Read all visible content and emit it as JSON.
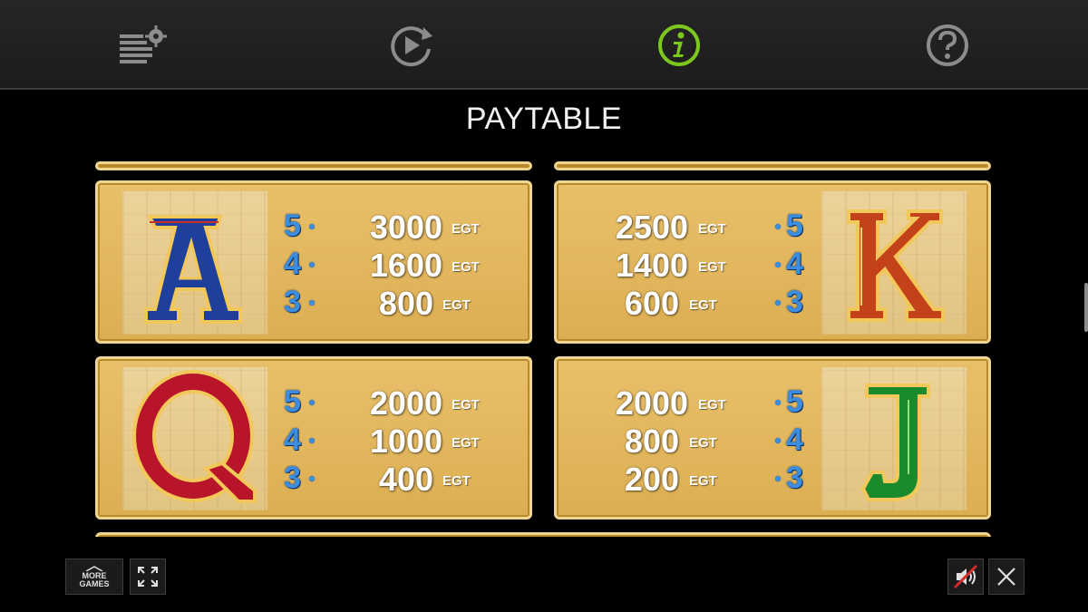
{
  "toolbar": {
    "icons": [
      "settings-stack-icon",
      "autoplay-replay-icon",
      "info-icon",
      "help-icon"
    ],
    "active_index": 2,
    "accent_color": "#7cc81e",
    "icon_color": "#8c8c8c"
  },
  "title": "PAYTABLE",
  "paytable": [
    {
      "symbol": "A",
      "symbol_color": "#1f3f9c",
      "rows": [
        {
          "count": "5",
          "amount": "3000",
          "unit": "EGT"
        },
        {
          "count": "4",
          "amount": "1600",
          "unit": "EGT"
        },
        {
          "count": "3",
          "amount": "800",
          "unit": "EGT"
        }
      ]
    },
    {
      "symbol": "K",
      "symbol_color": "#c4421a",
      "rows": [
        {
          "count": "5",
          "amount": "2500",
          "unit": "EGT"
        },
        {
          "count": "4",
          "amount": "1400",
          "unit": "EGT"
        },
        {
          "count": "3",
          "amount": "600",
          "unit": "EGT"
        }
      ]
    },
    {
      "symbol": "Q",
      "symbol_color": "#b8152a",
      "rows": [
        {
          "count": "5",
          "amount": "2000",
          "unit": "EGT"
        },
        {
          "count": "4",
          "amount": "1000",
          "unit": "EGT"
        },
        {
          "count": "3",
          "amount": "400",
          "unit": "EGT"
        }
      ]
    },
    {
      "symbol": "J",
      "symbol_color": "#1a8a2c",
      "rows": [
        {
          "count": "5",
          "amount": "2000",
          "unit": "EGT"
        },
        {
          "count": "4",
          "amount": "800",
          "unit": "EGT"
        },
        {
          "count": "3",
          "amount": "200",
          "unit": "EGT"
        }
      ]
    }
  ],
  "bottom": {
    "more_games_line1": "MORE",
    "more_games_line2": "GAMES",
    "fullscreen_icon": "fullscreen-icon",
    "sound_icon": "sound-muted-icon",
    "close_icon": "close-icon"
  }
}
